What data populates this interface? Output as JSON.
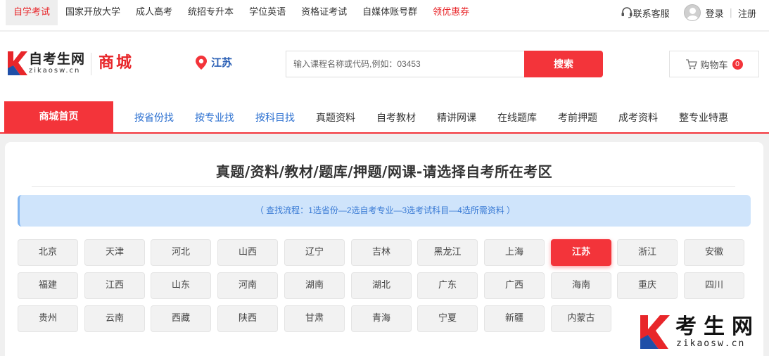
{
  "topbar": {
    "links": [
      {
        "label": "自学考试",
        "state": "active"
      },
      {
        "label": "国家开放大学",
        "state": ""
      },
      {
        "label": "成人高考",
        "state": ""
      },
      {
        "label": "统招专升本",
        "state": ""
      },
      {
        "label": "学位英语",
        "state": ""
      },
      {
        "label": "资格证考试",
        "state": ""
      },
      {
        "label": "自媒体账号群",
        "state": ""
      },
      {
        "label": "领优惠券",
        "state": "promo"
      }
    ],
    "service": "联系客服",
    "login": "登录",
    "separator": "|",
    "register": "注册"
  },
  "header": {
    "logo_cn": "自考生网",
    "logo_en": "zikaosw.cn",
    "mall": "商城",
    "province": "江苏",
    "search_placeholder": "输入课程名称或代码,例如：03453",
    "search_button": "搜索",
    "cart_label": "购物车",
    "cart_count": "0"
  },
  "nav": {
    "home": "商城首页",
    "items": [
      {
        "label": "按省份找",
        "style": "blue"
      },
      {
        "label": "按专业找",
        "style": "blue"
      },
      {
        "label": "按科目找",
        "style": "blue"
      },
      {
        "label": "真题资料",
        "style": ""
      },
      {
        "label": "自考教材",
        "style": ""
      },
      {
        "label": "精讲网课",
        "style": ""
      },
      {
        "label": "在线题库",
        "style": ""
      },
      {
        "label": "考前押题",
        "style": ""
      },
      {
        "label": "成考资料",
        "style": ""
      },
      {
        "label": "整专业特惠",
        "style": ""
      }
    ]
  },
  "main": {
    "title": "真题/资料/教材/题库/押题/网课-请选择自考所在考区",
    "flow": "（ 查找流程：1选省份—2选自考专业—3选考试科目—4选所需资料 ）",
    "selected": "江苏",
    "provinces": [
      "北京",
      "天津",
      "河北",
      "山西",
      "辽宁",
      "吉林",
      "黑龙江",
      "上海",
      "江苏",
      "浙江",
      "安徽",
      "福建",
      "江西",
      "山东",
      "河南",
      "湖南",
      "湖北",
      "广东",
      "广西",
      "海南",
      "重庆",
      "四川",
      "贵州",
      "云南",
      "西藏",
      "陕西",
      "甘肃",
      "青海",
      "宁夏",
      "新疆",
      "内蒙古"
    ]
  },
  "watermark": {
    "cn": "考生网",
    "en": "zikaosw.cn"
  },
  "colors": {
    "accent": "#f3343a",
    "nav_blue": "#2a6fd0",
    "province_blue": "#2a5fb5",
    "flow_bg": "#cfe4fb"
  }
}
